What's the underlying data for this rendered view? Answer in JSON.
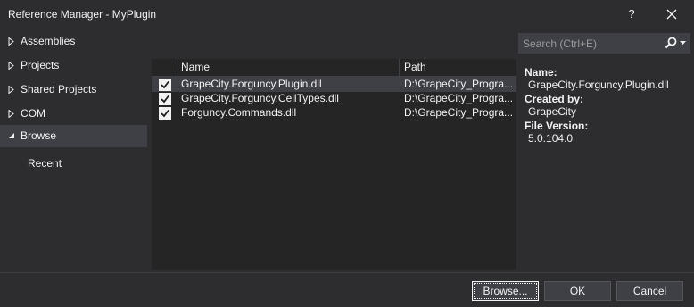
{
  "window": {
    "title": "Reference Manager - MyPlugin",
    "help_label": "?",
    "close_icon": "close-icon"
  },
  "nav": {
    "items": [
      {
        "label": "Assemblies",
        "expanded": false
      },
      {
        "label": "Projects",
        "expanded": false
      },
      {
        "label": "Shared Projects",
        "expanded": false
      },
      {
        "label": "COM",
        "expanded": false
      },
      {
        "label": "Browse",
        "expanded": true,
        "selected": true
      }
    ],
    "sub_items": [
      {
        "label": "Recent"
      }
    ]
  },
  "list": {
    "columns": [
      "Name",
      "Path"
    ],
    "rows": [
      {
        "checked": true,
        "name": "GrapeCity.Forguncy.Plugin.dll",
        "path": "D:\\GrapeCity_Progra...",
        "selected": true
      },
      {
        "checked": true,
        "name": "GrapeCity.Forguncy.CellTypes.dll",
        "path": "D:\\GrapeCity_Progra...",
        "selected": false
      },
      {
        "checked": true,
        "name": "Forguncy.Commands.dll",
        "path": "D:\\GrapeCity_Progra...",
        "selected": false
      }
    ]
  },
  "search": {
    "placeholder": "Search (Ctrl+E)",
    "value": ""
  },
  "details": {
    "name_label": "Name:",
    "name_value": "GrapeCity.Forguncy.Plugin.dll",
    "created_by_label": "Created by:",
    "created_by_value": "GrapeCity",
    "file_version_label": "File Version:",
    "file_version_value": "5.0.104.0"
  },
  "buttons": {
    "browse": "Browse...",
    "ok": "OK",
    "cancel": "Cancel"
  },
  "colors": {
    "background": "#2d2d30",
    "list_background": "#252526",
    "selection": "#3f3f46",
    "text": "#f1f1f1"
  }
}
